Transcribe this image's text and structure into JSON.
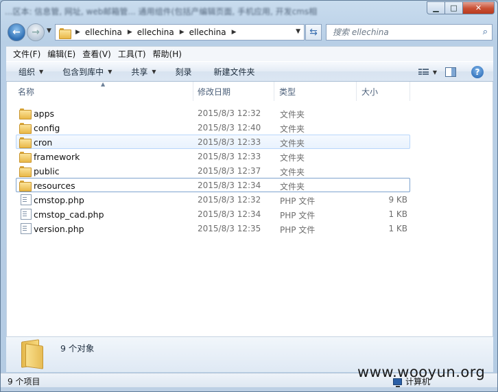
{
  "window": {
    "blurred_title": "...区本: 信息管, 网址, web邮箱管... 通用组件(包括产编辑页面, 手机应用, 开发cms相",
    "controls": {
      "minimize": "▁",
      "maximize": "□",
      "close": "✕"
    }
  },
  "address": {
    "breadcrumbs": [
      "ellechina",
      "ellechina",
      "ellechina"
    ],
    "search_placeholder": "搜索 ellechina"
  },
  "menu": [
    "文件(F)",
    "编辑(E)",
    "查看(V)",
    "工具(T)",
    "帮助(H)"
  ],
  "toolbar": {
    "organize": "组织",
    "include_library": "包含到库中",
    "share": "共享",
    "burn": "刻录",
    "new_folder": "新建文件夹"
  },
  "columns": {
    "name": "名称",
    "date": "修改日期",
    "type": "类型",
    "size": "大小"
  },
  "files": [
    {
      "name": "apps",
      "date": "2015/8/3 12:32",
      "type": "文件夹",
      "size": "",
      "icon": "folder-icon"
    },
    {
      "name": "config",
      "date": "2015/8/3 12:40",
      "type": "文件夹",
      "size": "",
      "icon": "folder-icon"
    },
    {
      "name": "cron",
      "date": "2015/8/3 12:33",
      "type": "文件夹",
      "size": "",
      "icon": "folder-icon"
    },
    {
      "name": "framework",
      "date": "2015/8/3 12:33",
      "type": "文件夹",
      "size": "",
      "icon": "folder-icon"
    },
    {
      "name": "public",
      "date": "2015/8/3 12:37",
      "type": "文件夹",
      "size": "",
      "icon": "folder-icon"
    },
    {
      "name": "resources",
      "date": "2015/8/3 12:34",
      "type": "文件夹",
      "size": "",
      "icon": "folder-icon"
    },
    {
      "name": "cmstop.php",
      "date": "2015/8/3 12:32",
      "type": "PHP 文件",
      "size": "9 KB",
      "icon": "file-icon"
    },
    {
      "name": "cmstop_cad.php",
      "date": "2015/8/3 12:34",
      "type": "PHP 文件",
      "size": "1 KB",
      "icon": "file-icon"
    },
    {
      "name": "version.php",
      "date": "2015/8/3 12:35",
      "type": "PHP 文件",
      "size": "1 KB",
      "icon": "file-icon"
    }
  ],
  "details": {
    "count": "9 个对象"
  },
  "status": {
    "items": "9 个项目",
    "computer": "计算机"
  },
  "watermark": "www.wooyun.org"
}
